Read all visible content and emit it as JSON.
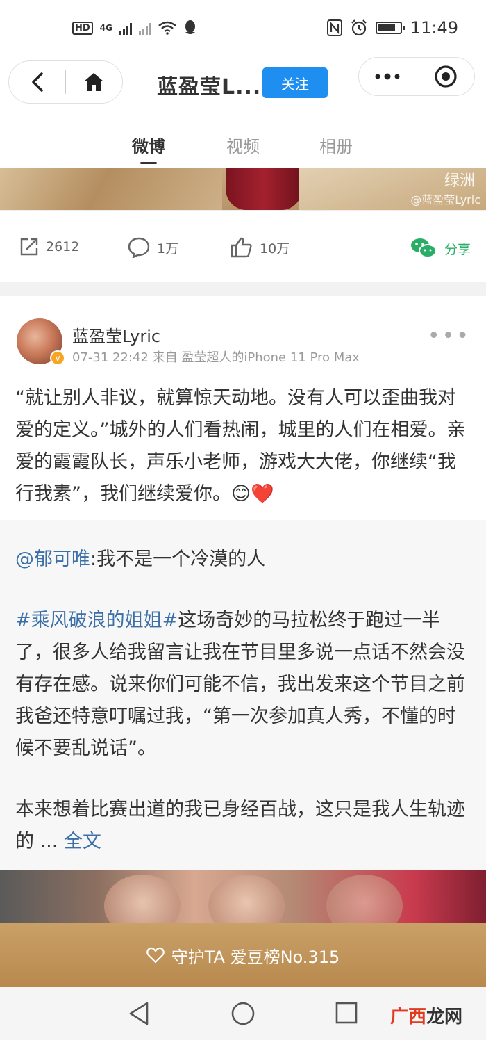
{
  "status_bar": {
    "left_badges": "HD",
    "net": "4G",
    "time": "11:49",
    "icons": [
      "nfc-icon",
      "alarm-icon",
      "battery-icon"
    ]
  },
  "header": {
    "title": "蓝盈莹L...",
    "follow_label": "关注",
    "icons": [
      "back-icon",
      "home-icon",
      "more-icon",
      "target-icon"
    ]
  },
  "tabs": [
    {
      "label": "微博",
      "active": true
    },
    {
      "label": "视频",
      "active": false
    },
    {
      "label": "相册",
      "active": false
    }
  ],
  "prev_post": {
    "watermark_main": "绿洲",
    "watermark_sub": "@蓝盈莹Lyric",
    "actions": {
      "repost_count": "2612",
      "comment_count": "1万",
      "like_count": "10万",
      "share_label": "分享"
    }
  },
  "post": {
    "username": "蓝盈莹Lyric",
    "meta": "07-31 22:42 来自 盈莹超人的iPhone 11 Pro Max",
    "more": "•••",
    "text": "“就让别人非议，就算惊天动地。没有人可以歪曲我对爱的定义。”城外的人们看热闹，城里的人们在相爱。亲爱的霞霞队长，声乐小老师，游戏大大佬，你继续“我行我素”，我们继续爱你。😊❤️"
  },
  "repost": {
    "mention": "@郁可唯",
    "mention_text": ":我不是一个冷漠的人",
    "hashtag": "#乘风破浪的姐姐#",
    "para1": "这场奇妙的马拉松终于跑过一半了，很多人给我留言让我在节目里多说一点话不然会没有存在感。说来你们可能不信，我出发来这个节目之前我爸还特意叮嘱过我，“第一次参加真人秀，不懂的时候不要乱说话”。",
    "para2": "本来想着比赛出道的我已身经百战，这只是我人生轨迹的 ...",
    "full_text_label": "全文"
  },
  "guard_bar": {
    "label": "守护TA 爱豆榜No.315"
  },
  "watermark": {
    "brand_red": "广西",
    "brand_black": "龙网"
  },
  "colors": {
    "follow_blue": "#1e8ff0",
    "link_blue": "#3b6fa8",
    "share_green": "#2aae67",
    "guard_gold": "#c49a5f"
  }
}
